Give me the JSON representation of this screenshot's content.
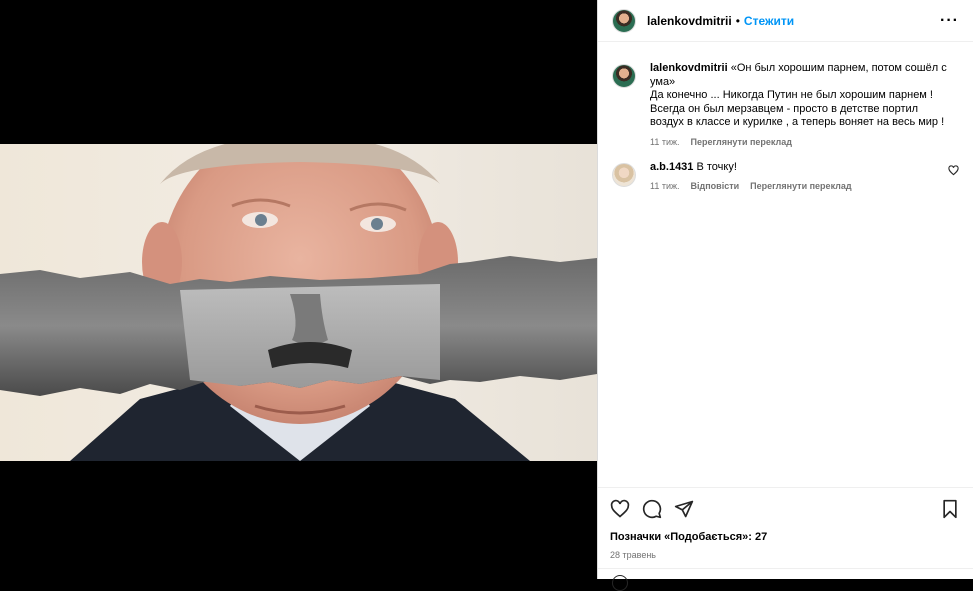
{
  "post": {
    "username": "lalenkovdmitrii",
    "dot": "•",
    "follow_label": "Стежити",
    "more_label": "···"
  },
  "comments": [
    {
      "username": "lalenkovdmitrii",
      "text": "«Он был хорошим парнем, потом сошёл с ума»\nДа конечно ... Никогда Путин не был хорошим парнем !\nВсегда он был мерзавцем - просто в детстве портил\nвоздух в классе и курилке , а теперь воняет на весь мир !",
      "time": "11 тиж.",
      "translate": "Переглянути переклад"
    },
    {
      "username": "a.b.1431",
      "text": "В точку!",
      "time": "11 тиж.",
      "reply": "Відповісти",
      "translate": "Переглянути переклад"
    }
  ],
  "footer": {
    "likes": "Позначки «Подобається»: 27",
    "date": "28 травень"
  },
  "icons": {
    "like": "heart-icon",
    "comment": "comment-icon",
    "share": "send-icon",
    "save": "bookmark-icon",
    "more": "more-icon"
  },
  "colors": {
    "accent": "#0095f6",
    "muted": "#737373"
  }
}
